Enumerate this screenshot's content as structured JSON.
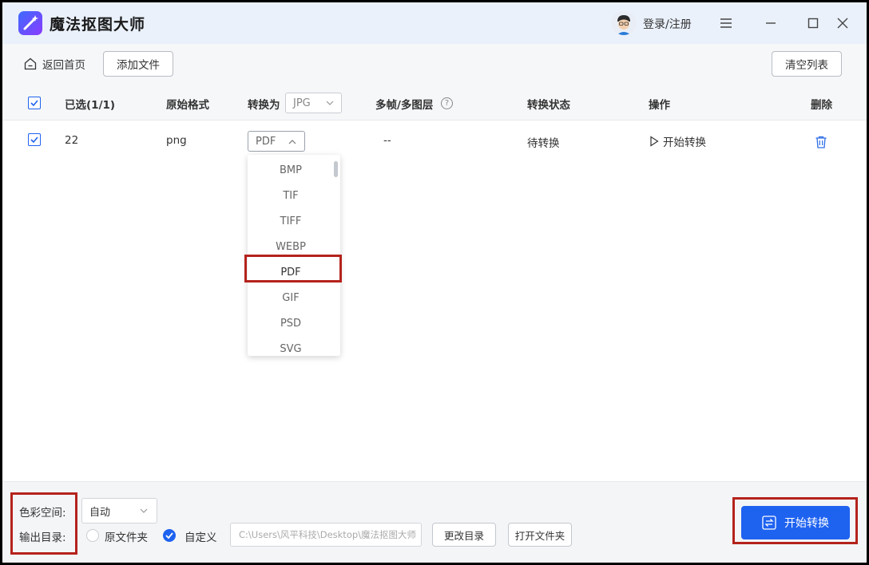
{
  "app": {
    "title": "魔法抠图大师",
    "login": "登录/注册"
  },
  "toolbar": {
    "back_label": "返回首页",
    "add_file_label": "添加文件",
    "clear_list_label": "清空列表"
  },
  "table": {
    "headers": {
      "selected": "已选(1/1)",
      "original_format": "原始格式",
      "convert_to": "转换为",
      "convert_to_value": "JPG",
      "multi_frame": "多帧/多图层",
      "status": "转换状态",
      "action": "操作",
      "delete": "删除"
    },
    "rows": [
      {
        "name": "22",
        "format": "png",
        "target": "PDF",
        "multi_frame": "--",
        "status": "待转换",
        "action": "开始转换",
        "checked": true
      }
    ]
  },
  "dropdown": {
    "options": [
      "BMP",
      "TIF",
      "TIFF",
      "WEBP",
      "PDF",
      "GIF",
      "PSD",
      "SVG"
    ],
    "selected": "PDF"
  },
  "footer": {
    "color_space_label": "色彩空间:",
    "color_space_value": "自动",
    "output_dir_label": "输出目录:",
    "option_original": "原文件夹",
    "option_custom": "自定义",
    "path": "C:\\Users\\风平科技\\Desktop\\魔法抠图大师",
    "change_dir_label": "更改目录",
    "open_folder_label": "打开文件夹",
    "start_label": "开始转换"
  },
  "colors": {
    "accent": "#1e62f0",
    "highlight": "#b4231c"
  }
}
